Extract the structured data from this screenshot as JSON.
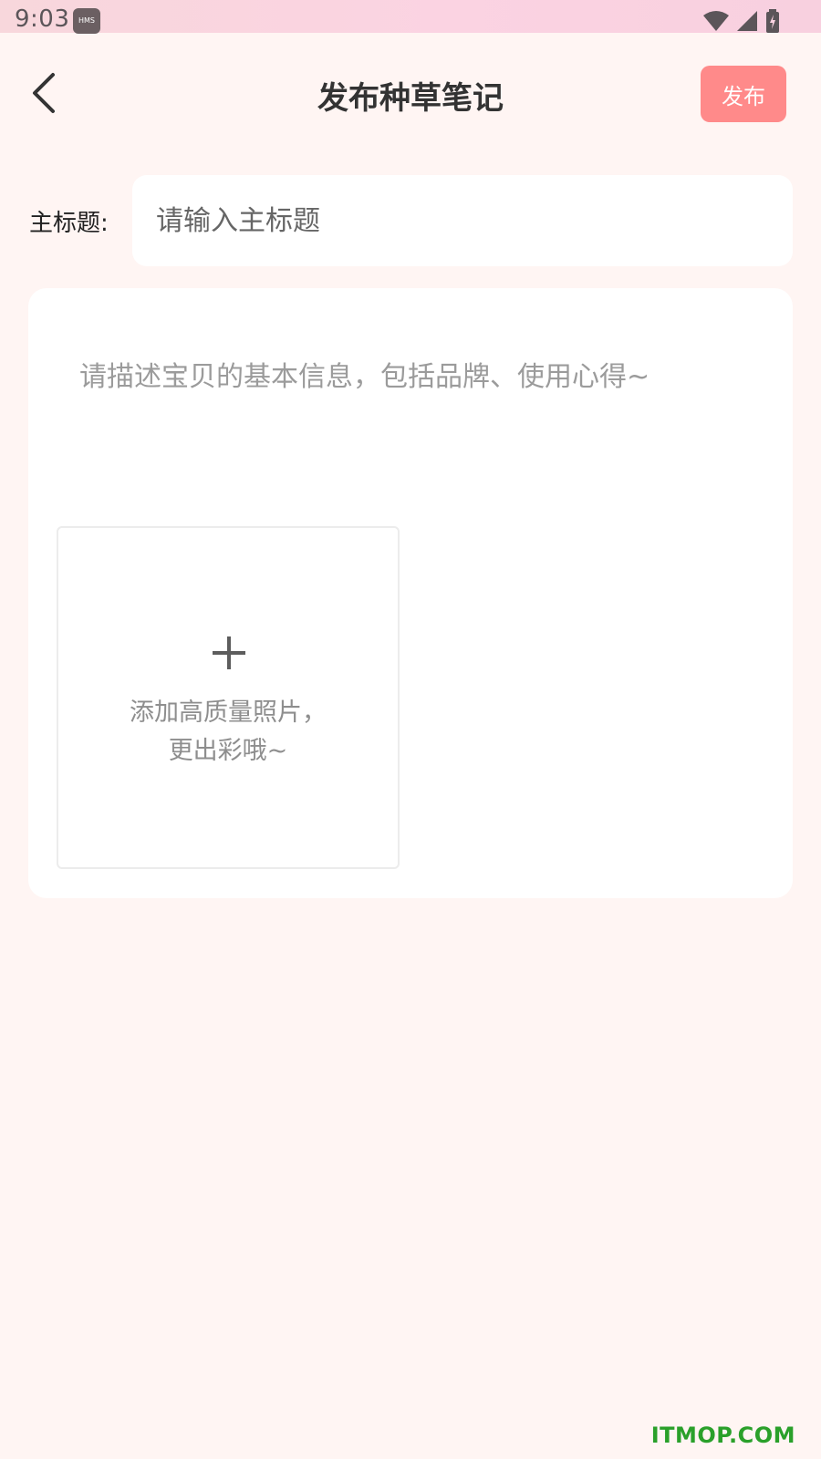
{
  "status_bar": {
    "time": "9:03",
    "hms_label": "HMS",
    "icons": [
      "wifi-icon",
      "signal-icon",
      "battery-charging-icon"
    ]
  },
  "header": {
    "back_icon": "chevron-left-icon",
    "title": "发布种草笔记",
    "publish_label": "发布",
    "publish_color": "#ff8a8a"
  },
  "form": {
    "title_label": "主标题:",
    "title_placeholder": "请输入主标题",
    "description_placeholder": "请描述宝贝的基本信息，包括品牌、使用心得~",
    "add_photo_icon": "plus-icon",
    "add_photo_line1": "添加高质量照片，",
    "add_photo_line2": "更出彩哦~"
  },
  "watermark": "ITMOP.COM"
}
